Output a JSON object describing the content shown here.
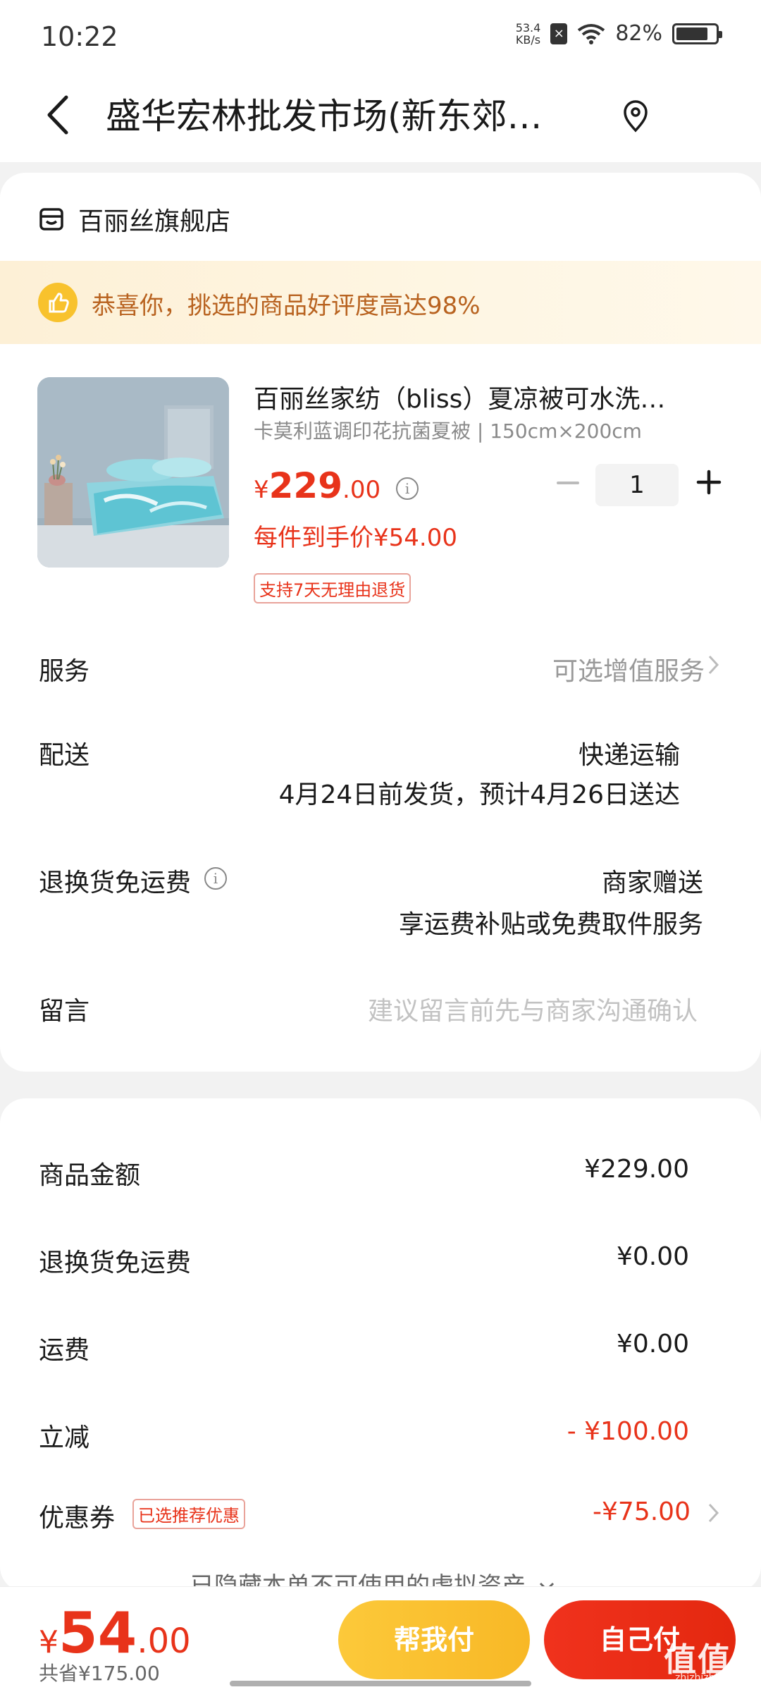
{
  "status_bar": {
    "time": "10:22",
    "net_speed_value": "53.4",
    "net_speed_unit": "KB/s",
    "battery": "82%",
    "battery_level": 0.82
  },
  "nav": {
    "title": "盛华宏林批发市场(新东郊…"
  },
  "store": {
    "name": "百丽丝旗舰店"
  },
  "banner": {
    "text": "恭喜你，挑选的商品好评度高达98%"
  },
  "product": {
    "title": "百丽丝家纺（bliss）夏凉被可水洗…",
    "spec": "卡莫利蓝调印花抗菌夏被 | 150cm×200cm",
    "price_symbol": "¥",
    "price_integer": "229",
    "price_decimal": ".00",
    "each_price": "每件到手价¥54.00",
    "return_tag": "支持7天无理由退货",
    "quantity": "1"
  },
  "rows": {
    "service_label": "服务",
    "service_value": "可选增值服务",
    "delivery_label": "配送",
    "delivery_method": "快递运输",
    "delivery_time": "4月24日前发货，预计4月26日送达",
    "return_ship_label": "退换货免运费",
    "return_ship_value": "商家赠送",
    "return_ship_desc": "享运费补贴或免费取件服务",
    "message_label": "留言",
    "message_placeholder": "建议留言前先与商家沟通确认"
  },
  "summary": {
    "goods_label": "商品金额",
    "goods_value": "¥229.00",
    "return_ship_label": "退换货免运费",
    "return_ship_value": "¥0.00",
    "shipping_label": "运费",
    "shipping_value": "¥0.00",
    "discount_label": "立减",
    "discount_value": "- ¥100.00",
    "coupon_label": "优惠券",
    "coupon_tag": "已选推荐优惠",
    "coupon_value": "-¥75.00",
    "hidden_assets": "已隐藏本单不可使用的虚拟资产"
  },
  "bottom": {
    "total_symbol": "¥",
    "total_integer": "54",
    "total_decimal": ".00",
    "saved": "共省¥175.00",
    "help_pay": "帮我付",
    "self_pay": "自己付",
    "watermark": "值值值",
    "watermark_sub": "zhizhizhi.com"
  },
  "colors": {
    "accent_red": "#e8331a",
    "help_yellow": "#fcc93a",
    "banner_text": "#b8621f"
  }
}
